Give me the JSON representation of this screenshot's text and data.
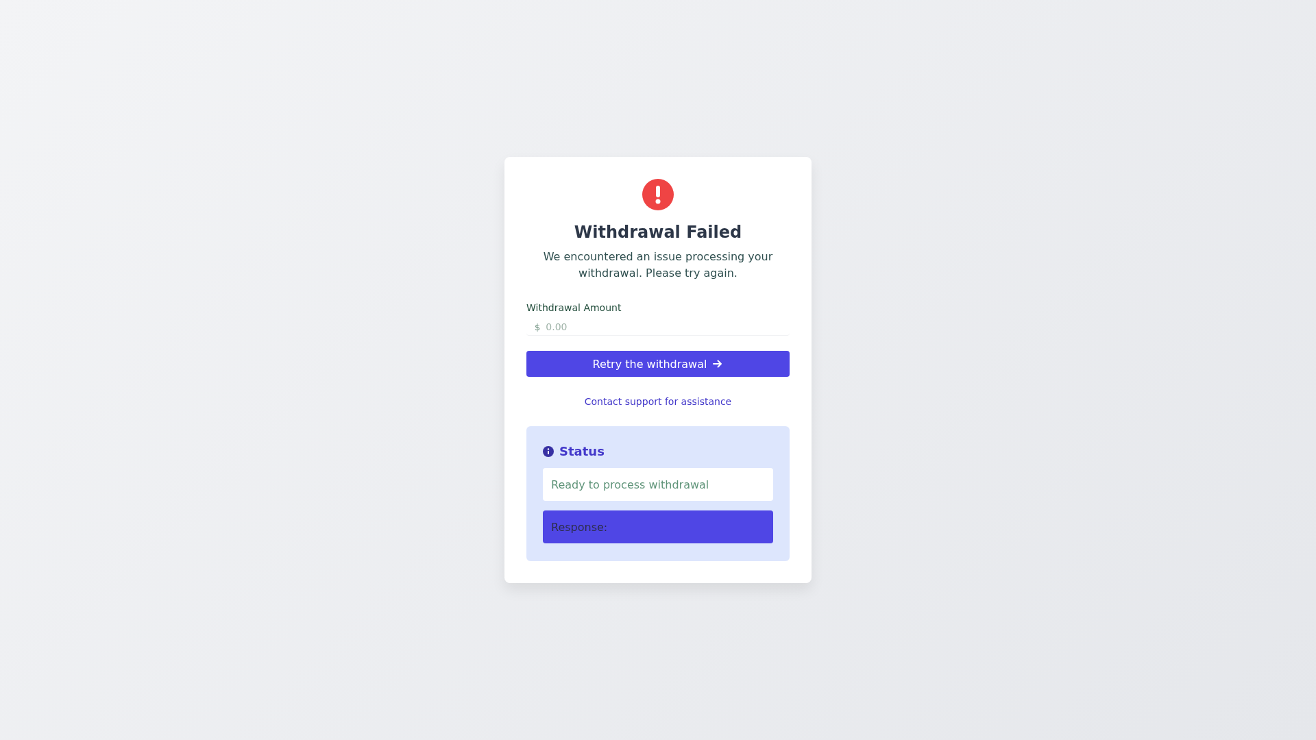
{
  "dialog": {
    "title": "Withdrawal Failed",
    "message": "We encountered an issue processing your withdrawal. Please try again."
  },
  "amount_field": {
    "label": "Withdrawal Amount",
    "currency": "$",
    "placeholder": "0.00"
  },
  "retry_button": {
    "label": "Retry the withdrawal"
  },
  "support_link": {
    "label": "Contact support for assistance"
  },
  "status_panel": {
    "title": "Status",
    "message": "Ready to process withdrawal",
    "response_label": "Response:"
  }
}
